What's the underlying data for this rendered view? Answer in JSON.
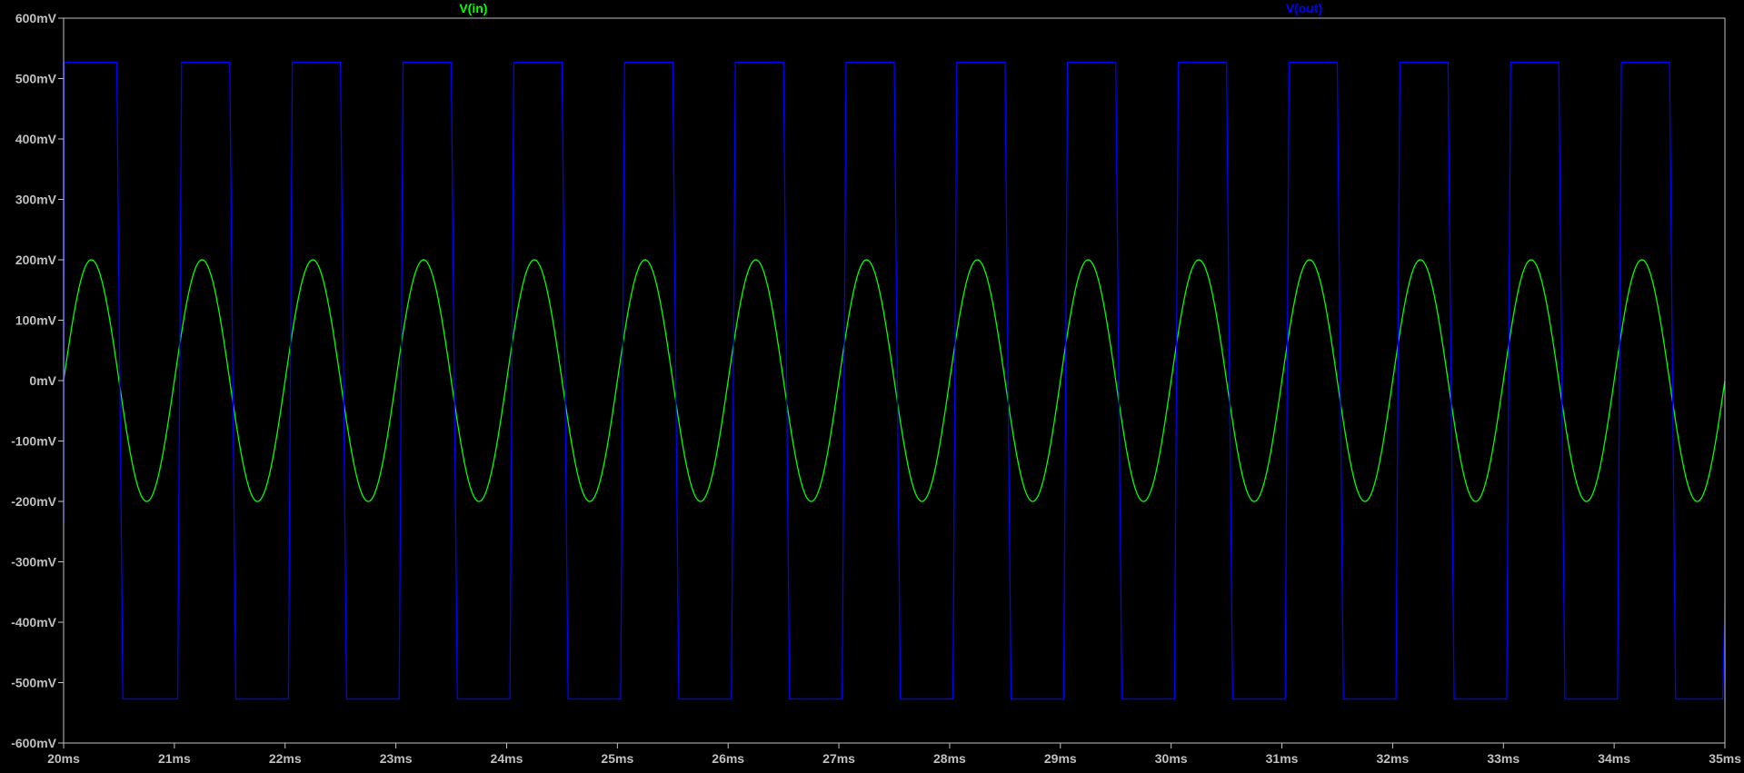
{
  "chart_data": {
    "type": "line",
    "title": "",
    "xlabel": "",
    "ylabel": "",
    "xlim": [
      20,
      35
    ],
    "ylim": [
      -600,
      600
    ],
    "x_ticks": [
      20,
      21,
      22,
      23,
      24,
      25,
      26,
      27,
      28,
      29,
      30,
      31,
      32,
      33,
      34,
      35
    ],
    "x_tick_labels": [
      "20ms",
      "21ms",
      "22ms",
      "23ms",
      "24ms",
      "25ms",
      "26ms",
      "27ms",
      "28ms",
      "29ms",
      "30ms",
      "31ms",
      "32ms",
      "33ms",
      "34ms",
      "35ms"
    ],
    "y_ticks": [
      600,
      500,
      400,
      300,
      200,
      100,
      0,
      -100,
      -200,
      -300,
      -400,
      -500,
      -600
    ],
    "y_tick_labels": [
      "600mV",
      "500mV",
      "400mV",
      "300mV",
      "200mV",
      "100mV",
      "0mV",
      "-100mV",
      "-200mV",
      "-300mV",
      "-400mV",
      "-500mV",
      "-600mV"
    ],
    "grid": false,
    "x_unit": "ms",
    "y_unit": "mV",
    "series": [
      {
        "name": "V(in)",
        "color": "#00ff00",
        "shape": "sine",
        "amplitude": 200,
        "period": 1.0,
        "offset": 0,
        "phase_zero_crossing_rising": 20.0
      },
      {
        "name": "V(out)",
        "color": "#0000ff",
        "shape": "square",
        "high": 527,
        "low": -527,
        "period": 1.0,
        "rising_edges": [
          20.0,
          21.03,
          22.03,
          23.03,
          24.03,
          25.03,
          26.03,
          27.03,
          28.03,
          29.03,
          30.03,
          31.03,
          32.03,
          33.03,
          34.03
        ],
        "falling_edges": [
          20.5,
          21.52,
          22.52,
          23.52,
          24.52,
          25.52,
          26.52,
          27.52,
          28.52,
          29.52,
          30.52,
          31.52,
          32.52,
          33.52,
          34.52
        ]
      }
    ],
    "legend": "top"
  },
  "colors": {
    "background": "#000000",
    "axis": "#c0c0c0",
    "tick_text": "#c0c0c0",
    "vin": "#00ff00",
    "vout": "#0000ff"
  }
}
